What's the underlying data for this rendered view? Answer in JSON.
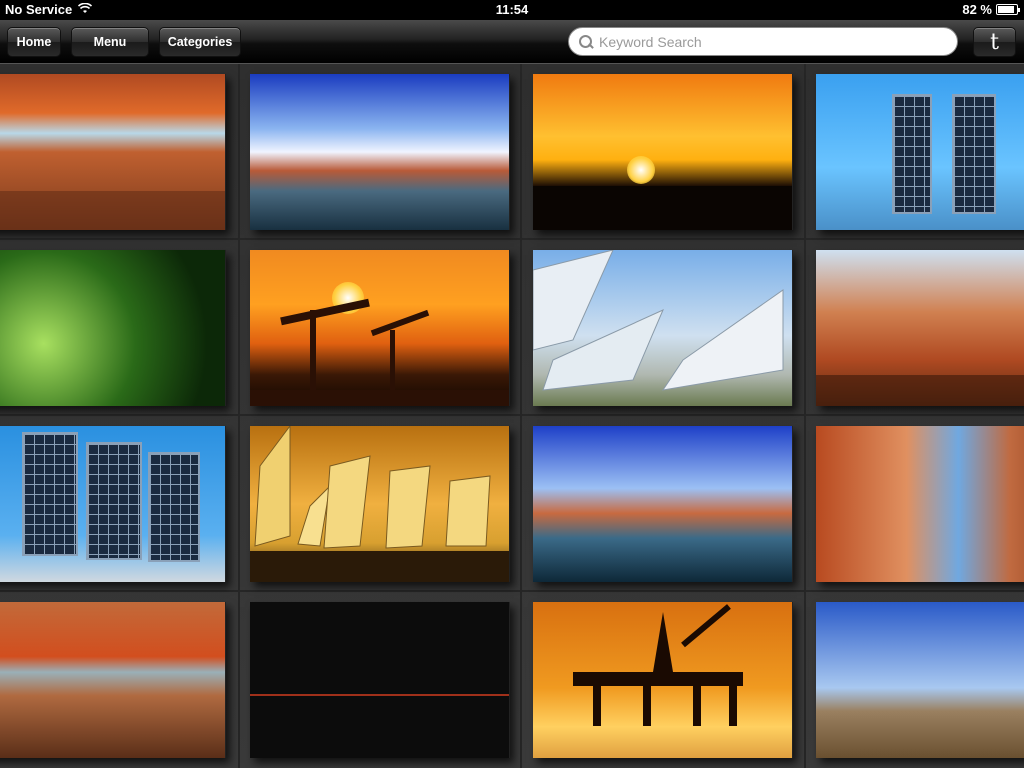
{
  "status_bar": {
    "carrier": "No Service",
    "time": "11:54",
    "battery": "82 %"
  },
  "toolbar": {
    "home_label": "Home",
    "menu_label": "Menu",
    "categories_label": "Categories",
    "search_placeholder": "Keyword Search",
    "twitter_glyph": "t"
  },
  "gallery": {
    "thumbnails": [
      {
        "scene": "desert-arch"
      },
      {
        "scene": "canyon-lake"
      },
      {
        "scene": "refinery-sunset"
      },
      {
        "scene": "solar-panels-sky"
      },
      {
        "scene": "jungle-leaves"
      },
      {
        "scene": "oil-pumpjacks-sunset"
      },
      {
        "scene": "solar-mirrors"
      },
      {
        "scene": "desert-tree"
      },
      {
        "scene": "solar-panels-blue"
      },
      {
        "scene": "golden-mirrors"
      },
      {
        "scene": "canyon-lake-2"
      },
      {
        "scene": "canyon-cliff"
      },
      {
        "scene": "desert-arch-2"
      },
      {
        "scene": "dark-horizon"
      },
      {
        "scene": "oil-rig-sunset"
      },
      {
        "scene": "driftwood-beach"
      }
    ]
  }
}
